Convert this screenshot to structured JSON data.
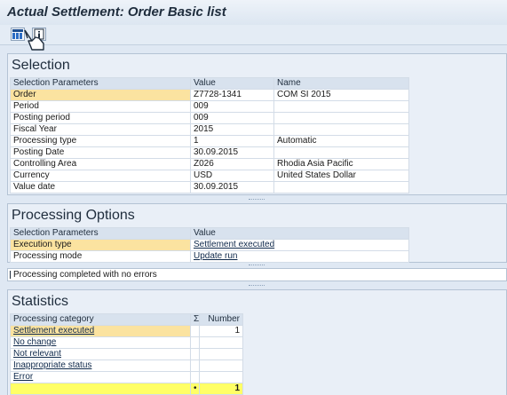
{
  "title": "Actual Settlement: Order Basic list",
  "toolbar": {
    "buttons": [
      {
        "icon": "layout-icon"
      },
      {
        "icon": "info-icon"
      }
    ]
  },
  "selection": {
    "title": "Selection",
    "headers": [
      "Selection Parameters",
      "Value",
      "Name"
    ],
    "rows": [
      {
        "param": "Order",
        "value": "Z7728-1341",
        "name": "COM SI 2015"
      },
      {
        "param": "Period",
        "value": "009",
        "name": ""
      },
      {
        "param": "Posting period",
        "value": "009",
        "name": ""
      },
      {
        "param": "Fiscal Year",
        "value": "2015",
        "name": ""
      },
      {
        "param": "Processing type",
        "value": "1",
        "name": "Automatic"
      },
      {
        "param": "Posting Date",
        "value": "30.09.2015",
        "name": ""
      },
      {
        "param": "Controlling Area",
        "value": "Z026",
        "name": "Rhodia Asia Pacific"
      },
      {
        "param": "Currency",
        "value": "USD",
        "name": "United States Dollar"
      },
      {
        "param": "Value date",
        "value": "30.09.2015",
        "name": ""
      }
    ]
  },
  "processing": {
    "title": "Processing Options",
    "headers": [
      "Selection Parameters",
      "Value"
    ],
    "rows": [
      {
        "param": "Execution type",
        "value": "Settlement executed"
      },
      {
        "param": "Processing mode",
        "value": "Update run"
      }
    ]
  },
  "status_message": "Processing completed with no errors",
  "statistics": {
    "title": "Statistics",
    "headers": [
      "Processing category",
      "Σ",
      "Number"
    ],
    "rows": [
      {
        "category": "Settlement executed",
        "number": "1"
      },
      {
        "category": "No change",
        "number": ""
      },
      {
        "category": "Not relevant",
        "number": ""
      },
      {
        "category": "Inappropriate status",
        "number": ""
      },
      {
        "category": "Error",
        "number": ""
      }
    ],
    "total": {
      "sigma": "•",
      "number": "1"
    }
  }
}
